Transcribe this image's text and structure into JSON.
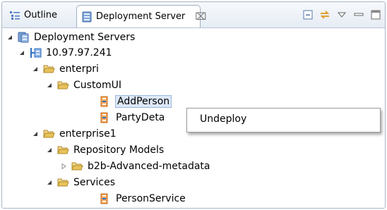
{
  "tabs": {
    "outline": "Outline",
    "deployment_server": "Deployment Server",
    "close_glyph": "⌧"
  },
  "tree": {
    "root": "Deployment Servers",
    "server": "10.97.97.241",
    "enterpri": "enterpri",
    "customui": "CustomUI",
    "addperson": "AddPerson",
    "partydeta": "PartyDeta",
    "enterprise1": "enterprise1",
    "repo_models": "Repository Models",
    "b2b": "b2b-Advanced-metadata",
    "services": "Services",
    "personservice": "PersonService"
  },
  "context_menu": {
    "undeploy": "Undeploy"
  },
  "colors": {
    "folder": "#e8c25a",
    "server_icon": "#5a8fd0",
    "service_icon": "#d9792f"
  }
}
